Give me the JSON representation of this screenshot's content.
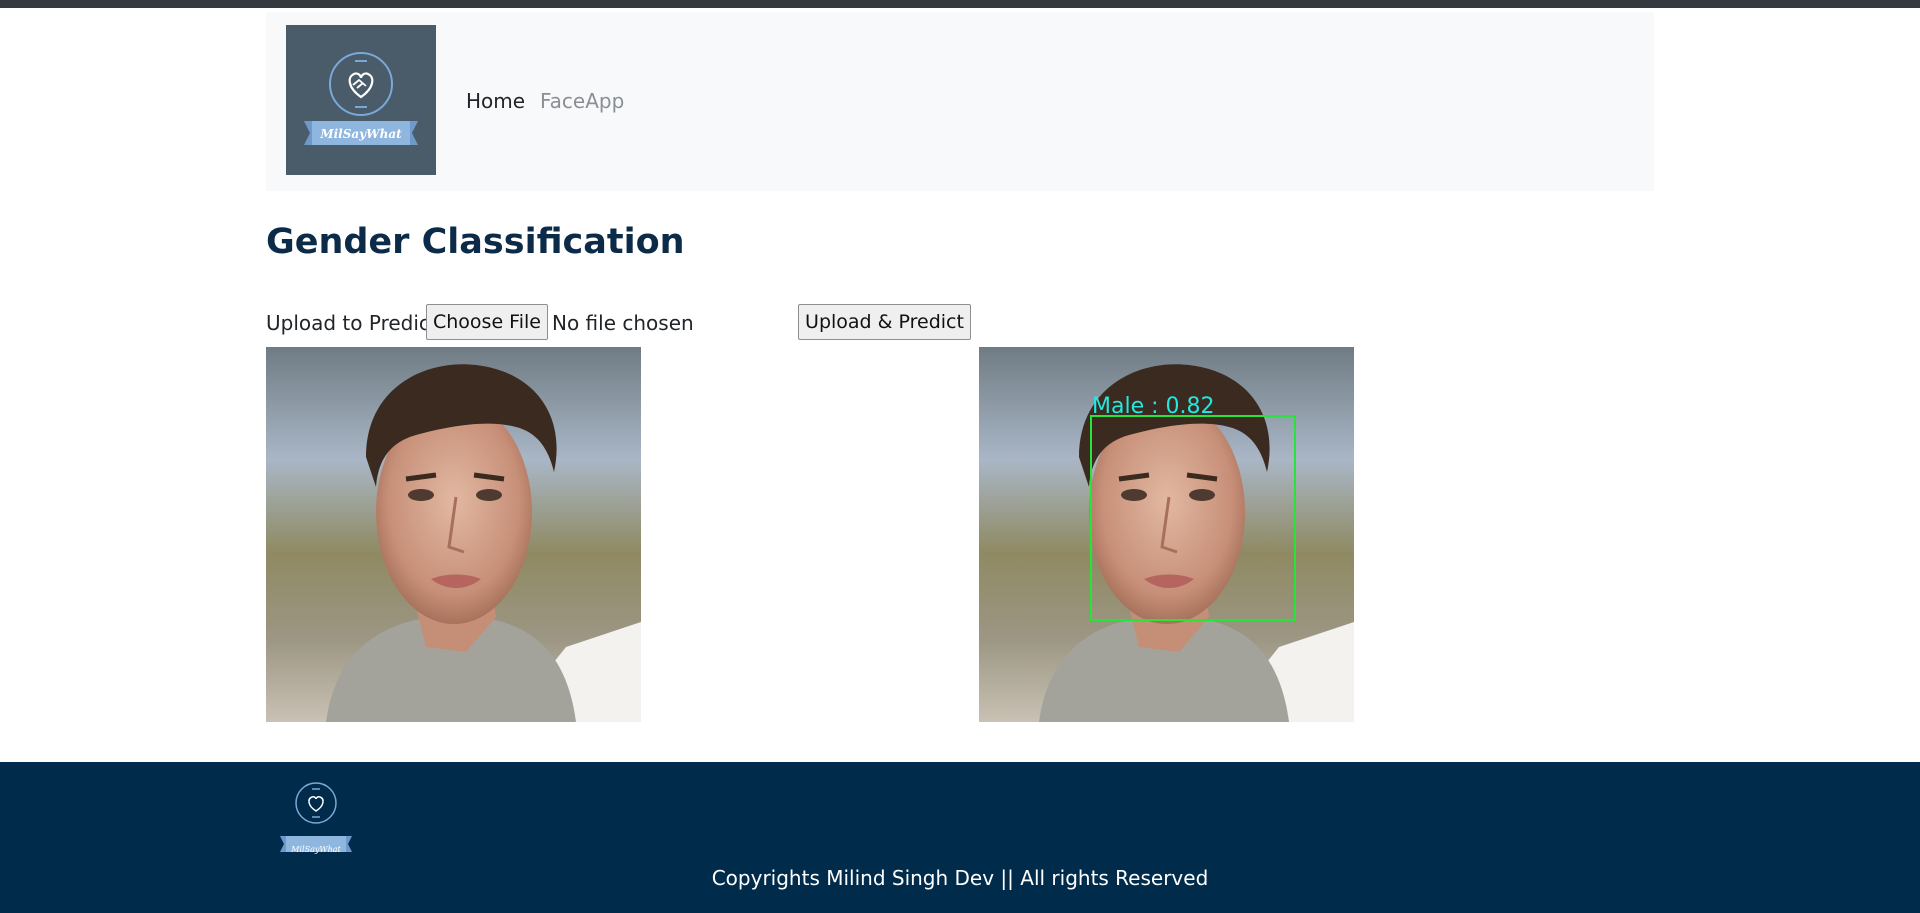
{
  "brand": {
    "name": "MilSayWhat"
  },
  "nav": {
    "items": [
      {
        "label": "Home"
      },
      {
        "label": "FaceApp"
      }
    ]
  },
  "page": {
    "title": "Gender Classification"
  },
  "upload": {
    "label": "Upload to Predict",
    "choose_button": "Choose File",
    "file_status": "No file chosen",
    "submit_button": "Upload & Predict"
  },
  "result": {
    "prediction_label": "Male : 0.82",
    "box_color": "#27e33a",
    "label_color": "#22e8e0"
  },
  "footer": {
    "copyright": "Copyrights Milind Singh Dev || All rights Reserved"
  },
  "colors": {
    "title": "#0c2b48",
    "footer_bg": "#012b4a",
    "navbar_bg": "#f8f9fa",
    "logo_bg": "#4a5b6a",
    "logo_accent": "#7aa8d8"
  },
  "icons": [
    "handshake-heart-icon",
    "ribbon-banner-icon"
  ]
}
